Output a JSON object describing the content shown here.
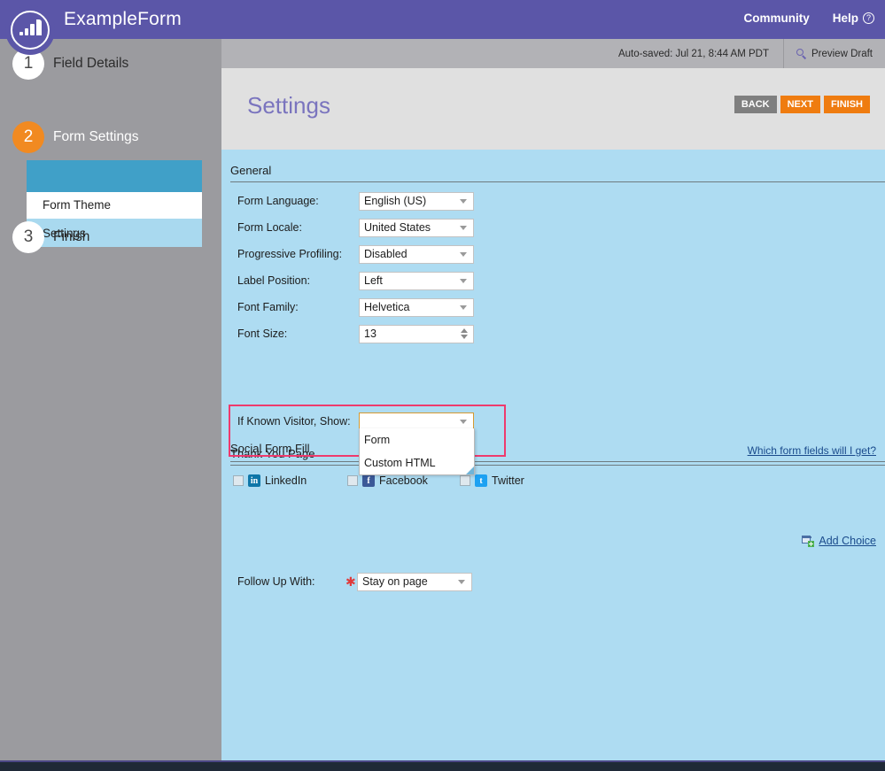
{
  "topbar": {
    "app_title": "ExampleForm",
    "community_label": "Community",
    "help_label": "Help",
    "help_icon": "question-mark-circle-icon",
    "logo_icon": "marketo-bars-circle-logo"
  },
  "subbar": {
    "autosave_text": "Auto-saved: Jul 21, 8:44 AM PDT",
    "preview_label": "Preview Draft",
    "preview_icon": "magnifier-icon"
  },
  "sidebar": {
    "steps": [
      {
        "number": "1",
        "label": "Field Details",
        "active": false
      },
      {
        "number": "2",
        "label": "Form Settings",
        "active": true
      },
      {
        "number": "3",
        "label": "Finish",
        "active": false
      }
    ],
    "subitems": [
      {
        "label": "Form Theme",
        "selected": false
      },
      {
        "label": "Settings",
        "selected": true
      }
    ]
  },
  "page": {
    "title": "Settings",
    "buttons": {
      "back": "BACK",
      "next": "NEXT",
      "finish": "FINISH"
    }
  },
  "sections": {
    "general_title": "General",
    "social_title": "Social Form Fill",
    "thankyou_title": "Thank You Page"
  },
  "general_fields": [
    {
      "label": "Form Language:",
      "value": "English (US)",
      "control": "select"
    },
    {
      "label": "Form Locale:",
      "value": "United States",
      "control": "select"
    },
    {
      "label": "Progressive Profiling:",
      "value": "Disabled",
      "control": "select"
    },
    {
      "label": "Label Position:",
      "value": "Left",
      "control": "select"
    },
    {
      "label": "Font Family:",
      "value": "Helvetica",
      "control": "select"
    },
    {
      "label": "Font Size:",
      "value": "13",
      "control": "spinner"
    }
  ],
  "known_visitor": {
    "label": "If Known Visitor, Show:",
    "value": "",
    "options": [
      "Form",
      "Custom HTML"
    ],
    "open": true,
    "highlight_color": "#ee3a6d",
    "focus_border_color": "#d49a32"
  },
  "social": {
    "which_fields_link": "Which form fields will I get?",
    "items": [
      {
        "name": "LinkedIn",
        "icon": "linkedin-icon",
        "glyph": "in",
        "checked": false,
        "color": "#0e76a8"
      },
      {
        "name": "Facebook",
        "icon": "facebook-icon",
        "glyph": "f",
        "checked": false,
        "color": "#3b5998"
      },
      {
        "name": "Twitter",
        "icon": "twitter-icon",
        "glyph": "t",
        "checked": false,
        "color": "#1da1f2"
      }
    ]
  },
  "thankyou": {
    "add_choice_label": "Add Choice",
    "add_choice_icon": "add-window-plus-icon",
    "followup_label": "Follow Up With:",
    "followup_value": "Stay on page",
    "required_marker": "★"
  },
  "colors": {
    "header_purple": "#5b56a8",
    "sidebar_grey": "#9b9b9f",
    "panel_blue": "#aedcf2",
    "accent_orange": "#f18a21",
    "step_band_teal": "#40a0c8",
    "title_violet": "#7a74be"
  }
}
